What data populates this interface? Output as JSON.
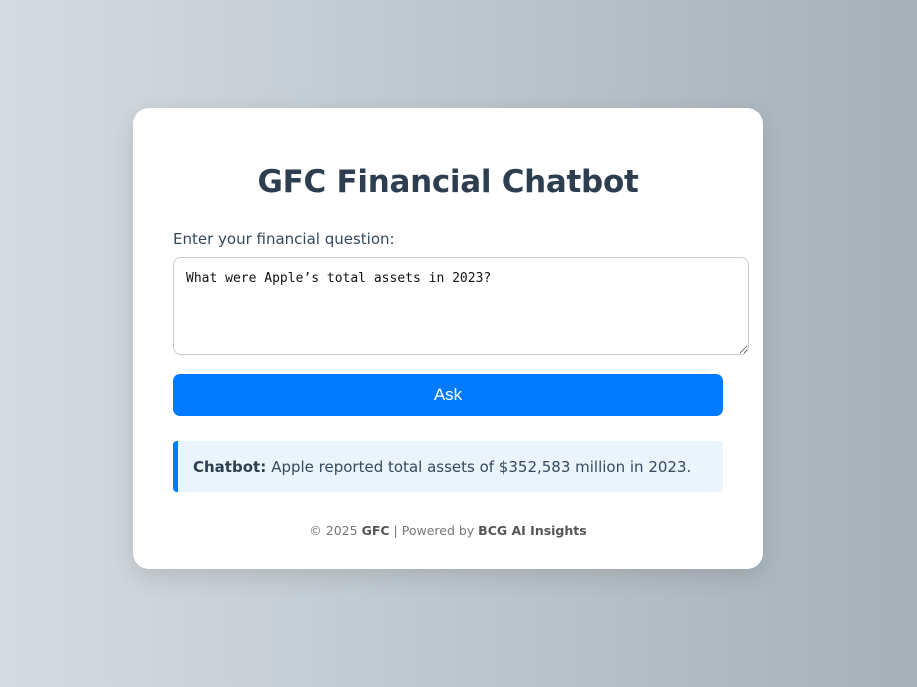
{
  "app": {
    "title": "GFC Financial Chatbot"
  },
  "form": {
    "label": "Enter your financial question:",
    "question_value": "What were Apple’s total assets in 2023?",
    "ask_label": "Ask"
  },
  "answer": {
    "speaker": "Chatbot:",
    "text": "Apple reported total assets of $352,583 million in 2023."
  },
  "footer": {
    "copyright": "© 2025",
    "brand": "GFC",
    "separator": "| Powered by",
    "provider": "BCG AI Insights"
  },
  "colors": {
    "accent": "#007bff",
    "title": "#2c3e50",
    "answer_bg": "#eaf4fd"
  }
}
